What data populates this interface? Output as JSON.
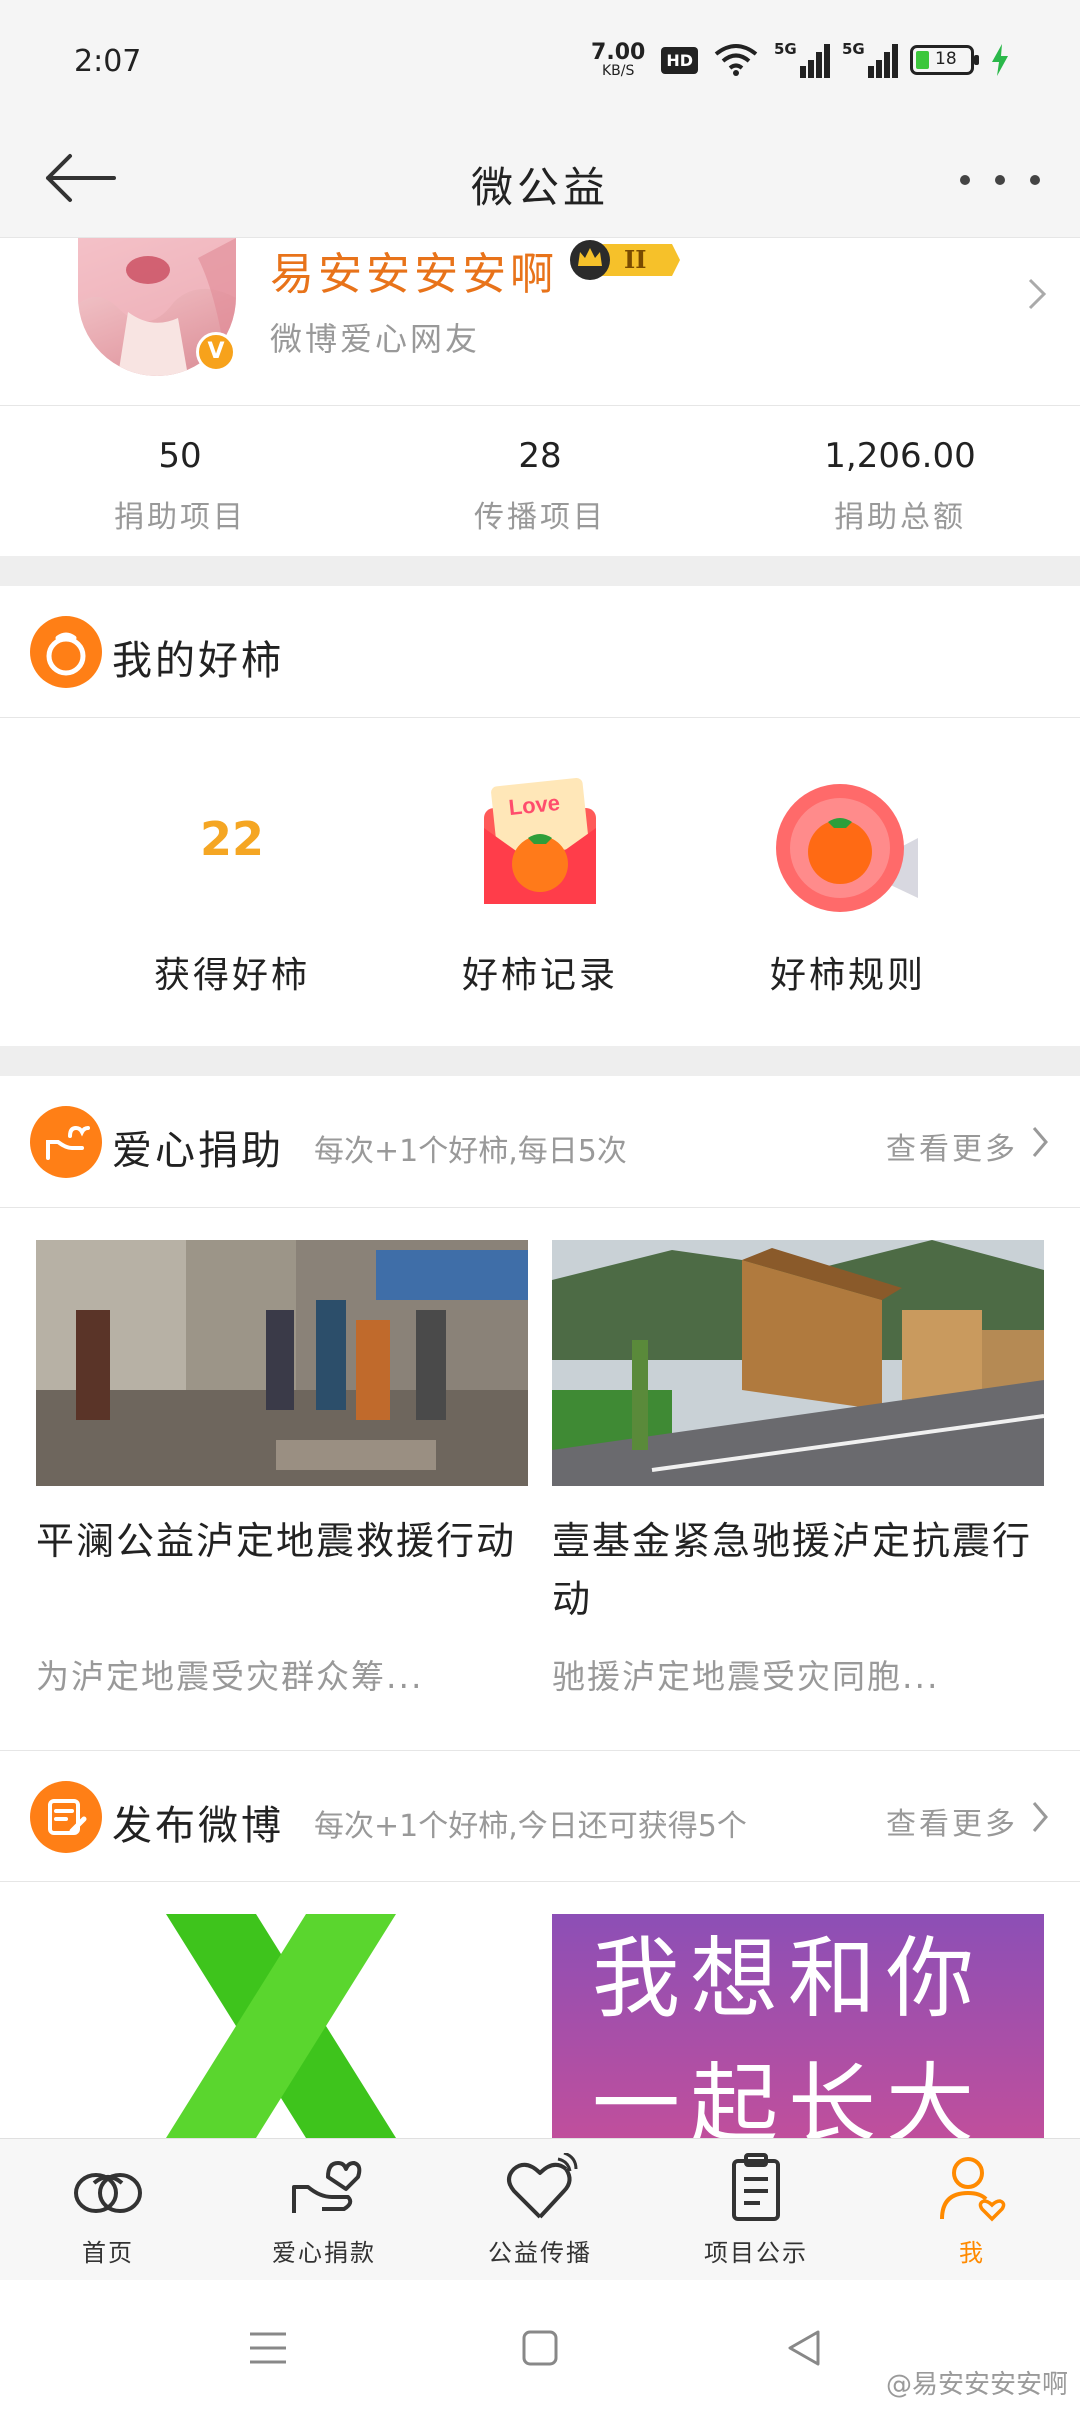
{
  "status_bar": {
    "time": "2:07",
    "net_speed": "7.00",
    "net_unit": "KB/S",
    "hd": "HD",
    "signal1": "5G",
    "signal2": "5G",
    "battery": "18"
  },
  "nav": {
    "title": "微公益",
    "back_icon": "back-arrow-icon",
    "more_icon": "more-dots-icon"
  },
  "profile": {
    "name": "易安安安安啊",
    "level_badge": "II",
    "avatar_badge": "V",
    "subtitle": "微博爱心网友"
  },
  "stats": [
    {
      "value": "50",
      "label": "捐助项目"
    },
    {
      "value": "28",
      "label": "传播项目"
    },
    {
      "value": "1,206.00",
      "label": "捐助总额"
    }
  ],
  "haoshi": {
    "title": "我的好柿",
    "items": [
      {
        "value": "22",
        "label": "获得好柿"
      },
      {
        "label": "好柿记录",
        "icon": "love-envelope-persimmon-icon",
        "badge": "Love"
      },
      {
        "label": "好柿规则",
        "icon": "megaphone-persimmon-icon"
      }
    ]
  },
  "donation": {
    "title": "爱心捐助",
    "desc": "每次+1个好柿,每日5次",
    "more": "查看更多",
    "cards": [
      {
        "title": "平澜公益泸定地震救援行动",
        "desc": "为泸定地震受灾群众筹..."
      },
      {
        "title": "壹基金紧急驰援泸定抗震行动",
        "desc": "驰援泸定地震受灾同胞..."
      }
    ]
  },
  "weibo": {
    "title": "发布微博",
    "desc": "每次+1个好柿,今日还可获得5个",
    "more": "查看更多",
    "cards": [
      {
        "image": "green-ribbon-image"
      },
      {
        "image_text_line1": "我想和你",
        "image_text_line2": "一起长大"
      }
    ]
  },
  "tabs": [
    {
      "label": "首页",
      "icon": "home-icon"
    },
    {
      "label": "爱心捐款",
      "icon": "donate-hand-heart-icon"
    },
    {
      "label": "公益传播",
      "icon": "share-heart-icon"
    },
    {
      "label": "项目公示",
      "icon": "clipboard-icon"
    },
    {
      "label": "我",
      "icon": "profile-icon",
      "active": true
    }
  ],
  "colors": {
    "accent": "#ff8a00",
    "name": "#e8731a",
    "muted": "#999999"
  },
  "watermark": "@易安安安安啊"
}
